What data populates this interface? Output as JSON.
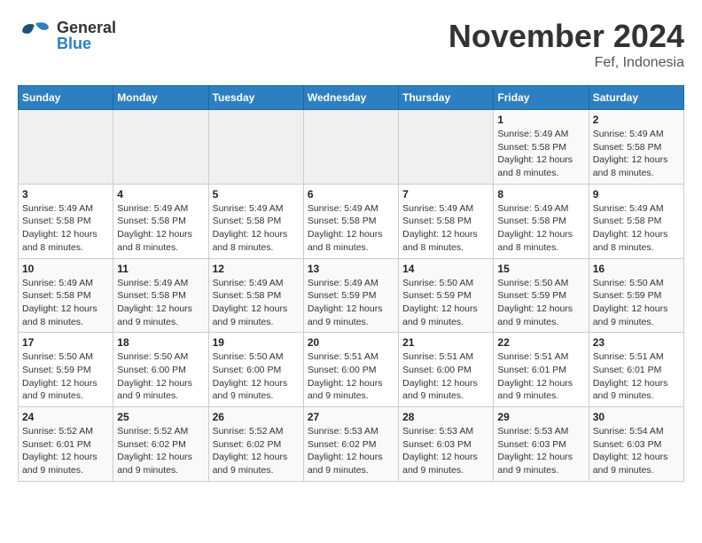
{
  "header": {
    "logo_general": "General",
    "logo_blue": "Blue",
    "month_title": "November 2024",
    "subtitle": "Fef, Indonesia"
  },
  "days_of_week": [
    "Sunday",
    "Monday",
    "Tuesday",
    "Wednesday",
    "Thursday",
    "Friday",
    "Saturday"
  ],
  "weeks": [
    [
      {
        "day": "",
        "info": ""
      },
      {
        "day": "",
        "info": ""
      },
      {
        "day": "",
        "info": ""
      },
      {
        "day": "",
        "info": ""
      },
      {
        "day": "",
        "info": ""
      },
      {
        "day": "1",
        "info": "Sunrise: 5:49 AM\nSunset: 5:58 PM\nDaylight: 12 hours and 8 minutes."
      },
      {
        "day": "2",
        "info": "Sunrise: 5:49 AM\nSunset: 5:58 PM\nDaylight: 12 hours and 8 minutes."
      }
    ],
    [
      {
        "day": "3",
        "info": "Sunrise: 5:49 AM\nSunset: 5:58 PM\nDaylight: 12 hours and 8 minutes."
      },
      {
        "day": "4",
        "info": "Sunrise: 5:49 AM\nSunset: 5:58 PM\nDaylight: 12 hours and 8 minutes."
      },
      {
        "day": "5",
        "info": "Sunrise: 5:49 AM\nSunset: 5:58 PM\nDaylight: 12 hours and 8 minutes."
      },
      {
        "day": "6",
        "info": "Sunrise: 5:49 AM\nSunset: 5:58 PM\nDaylight: 12 hours and 8 minutes."
      },
      {
        "day": "7",
        "info": "Sunrise: 5:49 AM\nSunset: 5:58 PM\nDaylight: 12 hours and 8 minutes."
      },
      {
        "day": "8",
        "info": "Sunrise: 5:49 AM\nSunset: 5:58 PM\nDaylight: 12 hours and 8 minutes."
      },
      {
        "day": "9",
        "info": "Sunrise: 5:49 AM\nSunset: 5:58 PM\nDaylight: 12 hours and 8 minutes."
      }
    ],
    [
      {
        "day": "10",
        "info": "Sunrise: 5:49 AM\nSunset: 5:58 PM\nDaylight: 12 hours and 8 minutes."
      },
      {
        "day": "11",
        "info": "Sunrise: 5:49 AM\nSunset: 5:58 PM\nDaylight: 12 hours and 9 minutes."
      },
      {
        "day": "12",
        "info": "Sunrise: 5:49 AM\nSunset: 5:58 PM\nDaylight: 12 hours and 9 minutes."
      },
      {
        "day": "13",
        "info": "Sunrise: 5:49 AM\nSunset: 5:59 PM\nDaylight: 12 hours and 9 minutes."
      },
      {
        "day": "14",
        "info": "Sunrise: 5:50 AM\nSunset: 5:59 PM\nDaylight: 12 hours and 9 minutes."
      },
      {
        "day": "15",
        "info": "Sunrise: 5:50 AM\nSunset: 5:59 PM\nDaylight: 12 hours and 9 minutes."
      },
      {
        "day": "16",
        "info": "Sunrise: 5:50 AM\nSunset: 5:59 PM\nDaylight: 12 hours and 9 minutes."
      }
    ],
    [
      {
        "day": "17",
        "info": "Sunrise: 5:50 AM\nSunset: 5:59 PM\nDaylight: 12 hours and 9 minutes."
      },
      {
        "day": "18",
        "info": "Sunrise: 5:50 AM\nSunset: 6:00 PM\nDaylight: 12 hours and 9 minutes."
      },
      {
        "day": "19",
        "info": "Sunrise: 5:50 AM\nSunset: 6:00 PM\nDaylight: 12 hours and 9 minutes."
      },
      {
        "day": "20",
        "info": "Sunrise: 5:51 AM\nSunset: 6:00 PM\nDaylight: 12 hours and 9 minutes."
      },
      {
        "day": "21",
        "info": "Sunrise: 5:51 AM\nSunset: 6:00 PM\nDaylight: 12 hours and 9 minutes."
      },
      {
        "day": "22",
        "info": "Sunrise: 5:51 AM\nSunset: 6:01 PM\nDaylight: 12 hours and 9 minutes."
      },
      {
        "day": "23",
        "info": "Sunrise: 5:51 AM\nSunset: 6:01 PM\nDaylight: 12 hours and 9 minutes."
      }
    ],
    [
      {
        "day": "24",
        "info": "Sunrise: 5:52 AM\nSunset: 6:01 PM\nDaylight: 12 hours and 9 minutes."
      },
      {
        "day": "25",
        "info": "Sunrise: 5:52 AM\nSunset: 6:02 PM\nDaylight: 12 hours and 9 minutes."
      },
      {
        "day": "26",
        "info": "Sunrise: 5:52 AM\nSunset: 6:02 PM\nDaylight: 12 hours and 9 minutes."
      },
      {
        "day": "27",
        "info": "Sunrise: 5:53 AM\nSunset: 6:02 PM\nDaylight: 12 hours and 9 minutes."
      },
      {
        "day": "28",
        "info": "Sunrise: 5:53 AM\nSunset: 6:03 PM\nDaylight: 12 hours and 9 minutes."
      },
      {
        "day": "29",
        "info": "Sunrise: 5:53 AM\nSunset: 6:03 PM\nDaylight: 12 hours and 9 minutes."
      },
      {
        "day": "30",
        "info": "Sunrise: 5:54 AM\nSunset: 6:03 PM\nDaylight: 12 hours and 9 minutes."
      }
    ]
  ]
}
